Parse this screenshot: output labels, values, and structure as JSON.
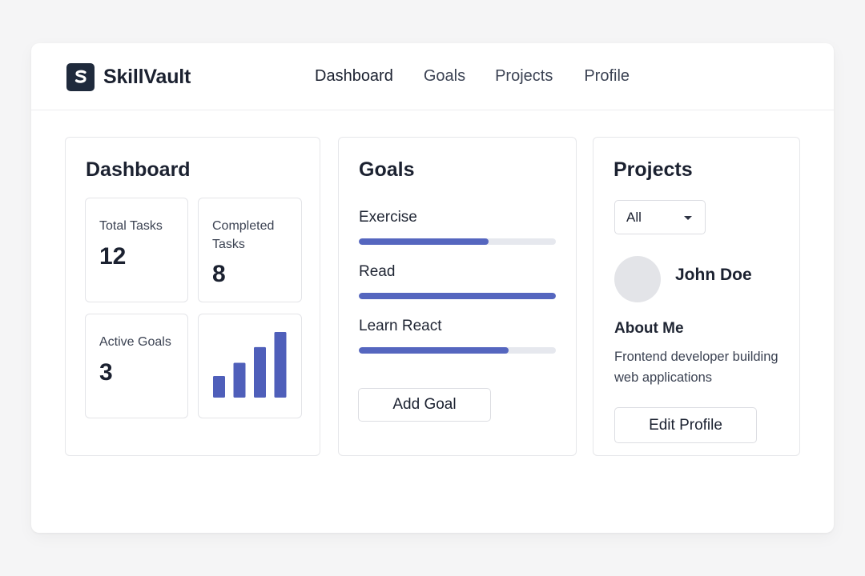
{
  "app": {
    "brand_name": "SkillVault",
    "logo_icon": "s-logo-icon"
  },
  "nav": {
    "items": [
      {
        "label": "Dashboard",
        "active": true
      },
      {
        "label": "Goals",
        "active": false
      },
      {
        "label": "Projects",
        "active": false
      },
      {
        "label": "Profile",
        "active": false
      }
    ]
  },
  "dashboard": {
    "title": "Dashboard",
    "stats": [
      {
        "label": "Total Tasks",
        "value": "12"
      },
      {
        "label": "Completed Tasks",
        "value": "8"
      },
      {
        "label": "Active Goals",
        "value": "3"
      }
    ],
    "mini_chart": {
      "type": "bar",
      "values": [
        0.33,
        0.53,
        0.77,
        1.0
      ],
      "color": "#4f5fba"
    }
  },
  "goals": {
    "title": "Goals",
    "items": [
      {
        "label": "Exercise",
        "progress": 0.66
      },
      {
        "label": "Read",
        "progress": 1.0
      },
      {
        "label": "Learn React",
        "progress": 0.76
      }
    ],
    "add_button": "Add Goal",
    "bar_color": "#5566bf"
  },
  "projects": {
    "title": "Projects",
    "filter_value": "All",
    "user_name": "John Doe",
    "about_title": "About Me",
    "about_text": "Frontend developer building web applications",
    "edit_button": "Edit Profile"
  }
}
